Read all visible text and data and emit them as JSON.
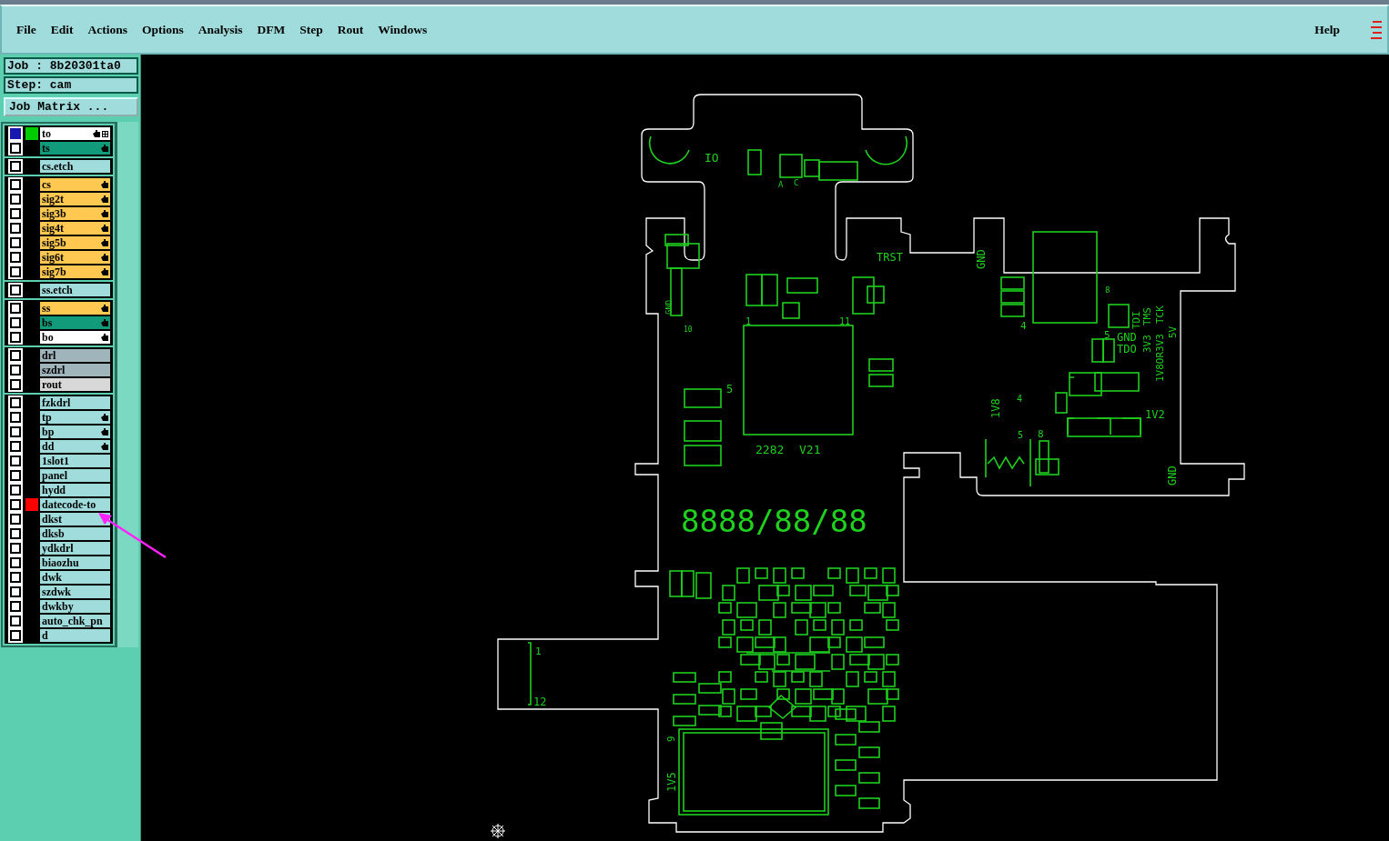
{
  "menu": [
    {
      "label": "File"
    },
    {
      "label": "Edit"
    },
    {
      "label": "Actions"
    },
    {
      "label": "Options"
    },
    {
      "label": "Analysis"
    },
    {
      "label": "DFM"
    },
    {
      "label": "Step"
    },
    {
      "label": "Rout"
    },
    {
      "label": "Windows"
    }
  ],
  "help": "Help",
  "job": "Job : 8b20301ta0",
  "step": "Step: cam",
  "job_matrix_button": "Job Matrix ...",
  "layer_groups": [
    {
      "layers": [
        {
          "name": "to",
          "kind": "silk",
          "color": "#00cc00",
          "selected": true,
          "hand": true
        },
        {
          "name": "ts",
          "kind": "mask",
          "selected": false,
          "hand": true
        }
      ]
    },
    {
      "layers": [
        {
          "name": "cs.etch",
          "kind": "document",
          "selected": false,
          "hand": false
        }
      ]
    },
    {
      "layers": [
        {
          "name": "cs",
          "kind": "signal",
          "selected": false,
          "hand": true
        },
        {
          "name": "sig2t",
          "kind": "signal",
          "selected": false,
          "hand": true
        },
        {
          "name": "sig3b",
          "kind": "signal",
          "selected": false,
          "hand": true
        },
        {
          "name": "sig4t",
          "kind": "signal",
          "selected": false,
          "hand": true
        },
        {
          "name": "sig5b",
          "kind": "signal",
          "selected": false,
          "hand": true
        },
        {
          "name": "sig6t",
          "kind": "signal",
          "selected": false,
          "hand": true
        },
        {
          "name": "sig7b",
          "kind": "signal",
          "selected": false,
          "hand": true
        }
      ]
    },
    {
      "layers": [
        {
          "name": "ss.etch",
          "kind": "document",
          "selected": false,
          "hand": false
        }
      ]
    },
    {
      "layers": [
        {
          "name": "ss",
          "kind": "signal",
          "selected": false,
          "hand": true
        },
        {
          "name": "bs",
          "kind": "mask",
          "selected": false,
          "hand": true
        },
        {
          "name": "bo",
          "kind": "silk",
          "selected": false,
          "hand": true
        }
      ]
    },
    {
      "layers": [
        {
          "name": "drl",
          "kind": "drill",
          "selected": false,
          "hand": false
        },
        {
          "name": "szdrl",
          "kind": "drill",
          "selected": false,
          "hand": false
        },
        {
          "name": "rout",
          "kind": "rout",
          "selected": false,
          "hand": false
        }
      ]
    },
    {
      "layers": [
        {
          "name": "fzkdrl",
          "kind": "document",
          "selected": false,
          "hand": false
        },
        {
          "name": "tp",
          "kind": "document",
          "selected": false,
          "hand": true
        },
        {
          "name": "bp",
          "kind": "document",
          "selected": false,
          "hand": true
        },
        {
          "name": "dd",
          "kind": "document",
          "selected": false,
          "hand": true
        },
        {
          "name": "1slot1",
          "kind": "document",
          "selected": false,
          "hand": false
        },
        {
          "name": "panel",
          "kind": "document",
          "selected": false,
          "hand": false
        },
        {
          "name": "hydd",
          "kind": "document",
          "selected": false,
          "hand": false
        },
        {
          "name": "datecode-to",
          "kind": "document",
          "color": "#ff0000",
          "selected": false,
          "hand": false
        },
        {
          "name": "dkst",
          "kind": "document",
          "selected": false,
          "hand": false
        },
        {
          "name": "dksb",
          "kind": "document",
          "selected": false,
          "hand": false
        },
        {
          "name": "ydkdrl",
          "kind": "document",
          "selected": false,
          "hand": false
        },
        {
          "name": "biaozhu",
          "kind": "document",
          "selected": false,
          "hand": false
        },
        {
          "name": "dwk",
          "kind": "document",
          "selected": false,
          "hand": false
        },
        {
          "name": "szdwk",
          "kind": "document",
          "selected": false,
          "hand": false
        },
        {
          "name": "dwkby",
          "kind": "document",
          "selected": false,
          "hand": false
        },
        {
          "name": "auto_chk_pn",
          "kind": "document",
          "selected": false,
          "hand": false
        },
        {
          "name": "d",
          "kind": "document",
          "selected": false,
          "hand": false
        }
      ]
    }
  ],
  "board_labels": [
    "IO",
    "A",
    "C",
    "TRST",
    "GND",
    "10",
    "1",
    "11",
    "5",
    "2282",
    "V21",
    "GND",
    "4",
    "8",
    "TDI",
    "TMS",
    "3V3",
    "TCK",
    "1V8OR3V3",
    "5V",
    "5",
    "GND",
    "TDO",
    "1V8",
    "4",
    "5",
    "8",
    "1V2",
    "GND",
    "8888/88/88",
    "1",
    "12",
    "9",
    "1V5"
  ]
}
